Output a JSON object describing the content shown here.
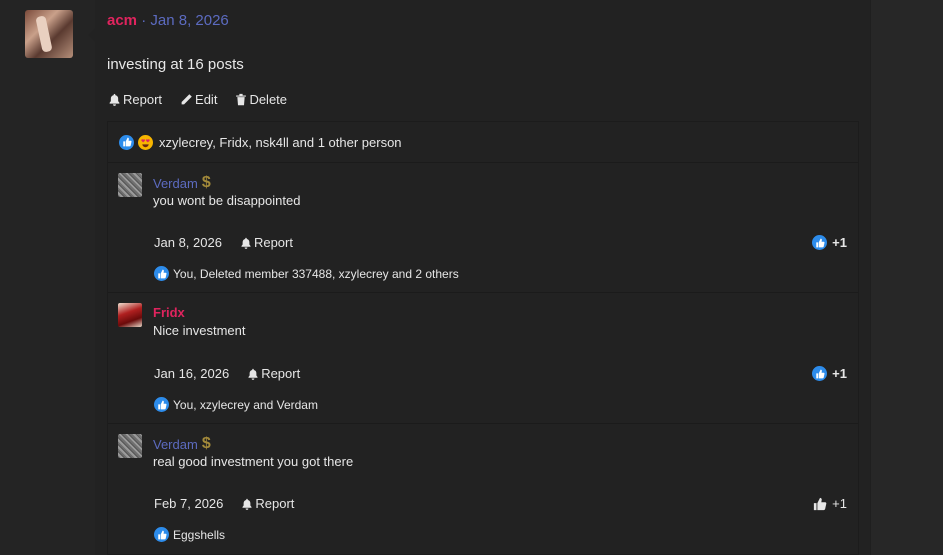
{
  "post": {
    "author": "acm",
    "separator": " · ",
    "date": "Jan 8, 2026",
    "body": "investing at 16 posts",
    "actions": {
      "report": "Report",
      "edit": "Edit",
      "delete": "Delete"
    },
    "reactions_summary": "xzylecrey, Fridx, nsk4ll and 1 other person"
  },
  "comments": [
    {
      "author": "Verdam",
      "badge": "$",
      "text": "you wont be disappointed",
      "date": "Jan 8, 2026",
      "report": "Report",
      "score": "+1",
      "reactions": "You, Deleted member 337488, xzylecrey and 2 others"
    },
    {
      "author": "Fridx",
      "text": "Nice investment",
      "date": "Jan 16, 2026",
      "report": "Report",
      "score": "+1",
      "reactions": "You, xzylecrey and Verdam"
    },
    {
      "author": "Verdam",
      "badge": "$",
      "text": "real good investment you got there",
      "date": "Feb 7, 2026",
      "report": "Report",
      "score": "+1",
      "reactions": "Eggshells"
    }
  ],
  "colors": {
    "accent_red": "#e0245e",
    "link_blue": "#5c6bc0",
    "like_blue": "#2d8ceb",
    "background": "#222222"
  },
  "icons": [
    "bell-icon",
    "pencil-icon",
    "trash-icon",
    "like-icon",
    "love-eyes-icon",
    "thumbs-up-icon",
    "dollar-badge-icon"
  ]
}
